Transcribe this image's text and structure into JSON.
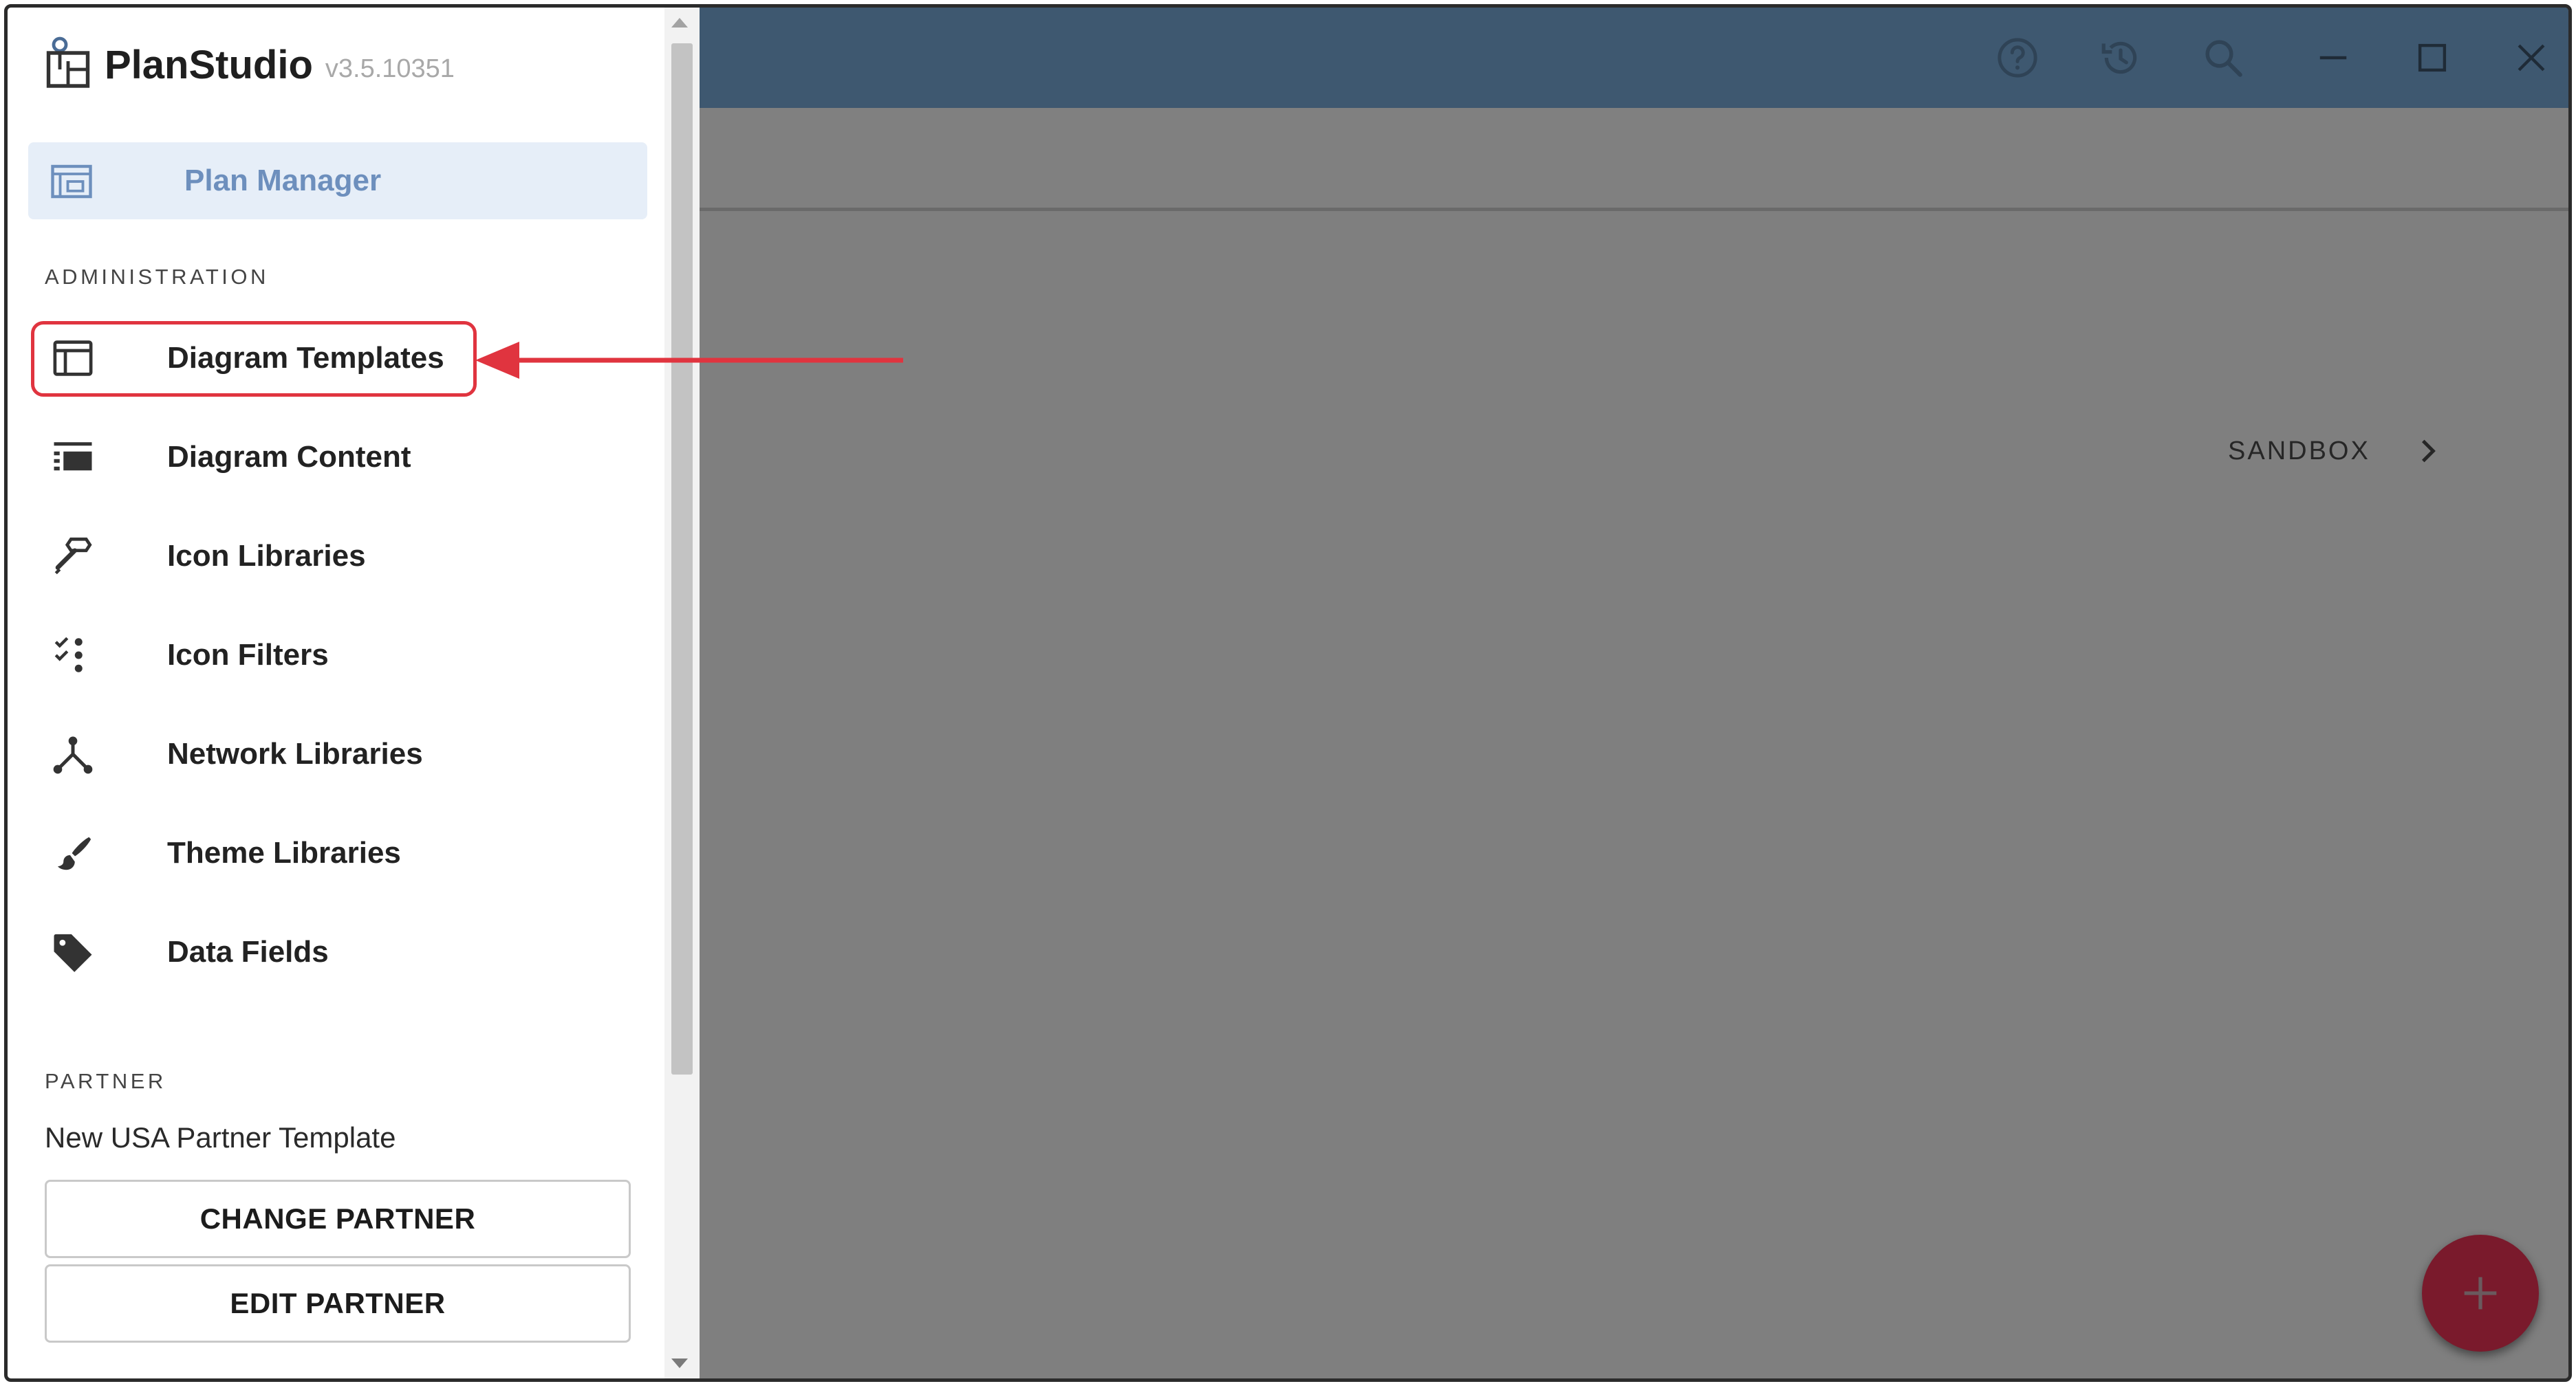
{
  "app": {
    "name": "PlanStudio",
    "version": "v3.5.10351"
  },
  "topbar": {
    "icons": [
      "help-icon",
      "history-icon",
      "search-icon",
      "minimize-icon",
      "maximize-icon",
      "close-icon"
    ]
  },
  "sidebar": {
    "plan_manager": {
      "label": "Plan Manager",
      "icon": "plan-manager-icon"
    },
    "administration_label": "ADMINISTRATION",
    "items": [
      {
        "label": "Diagram Templates",
        "icon": "template-icon"
      },
      {
        "label": "Diagram Content",
        "icon": "content-list-icon"
      },
      {
        "label": "Icon Libraries",
        "icon": "icon-library-icon"
      },
      {
        "label": "Icon Filters",
        "icon": "filter-list-icon"
      },
      {
        "label": "Network Libraries",
        "icon": "network-icon"
      },
      {
        "label": "Theme Libraries",
        "icon": "brush-icon"
      },
      {
        "label": "Data Fields",
        "icon": "tag-icon"
      }
    ],
    "partner_label": "PARTNER",
    "partner_name": "New USA Partner Template",
    "change_partner_label": "CHANGE PARTNER",
    "edit_partner_label": "EDIT PARTNER"
  },
  "main": {
    "breadcrumb": "SANDBOX"
  },
  "colors": {
    "topbar": "#3e5870",
    "accent": "#6d8fbd",
    "highlight": "#e0343f",
    "fab": "#7a1a2c"
  }
}
